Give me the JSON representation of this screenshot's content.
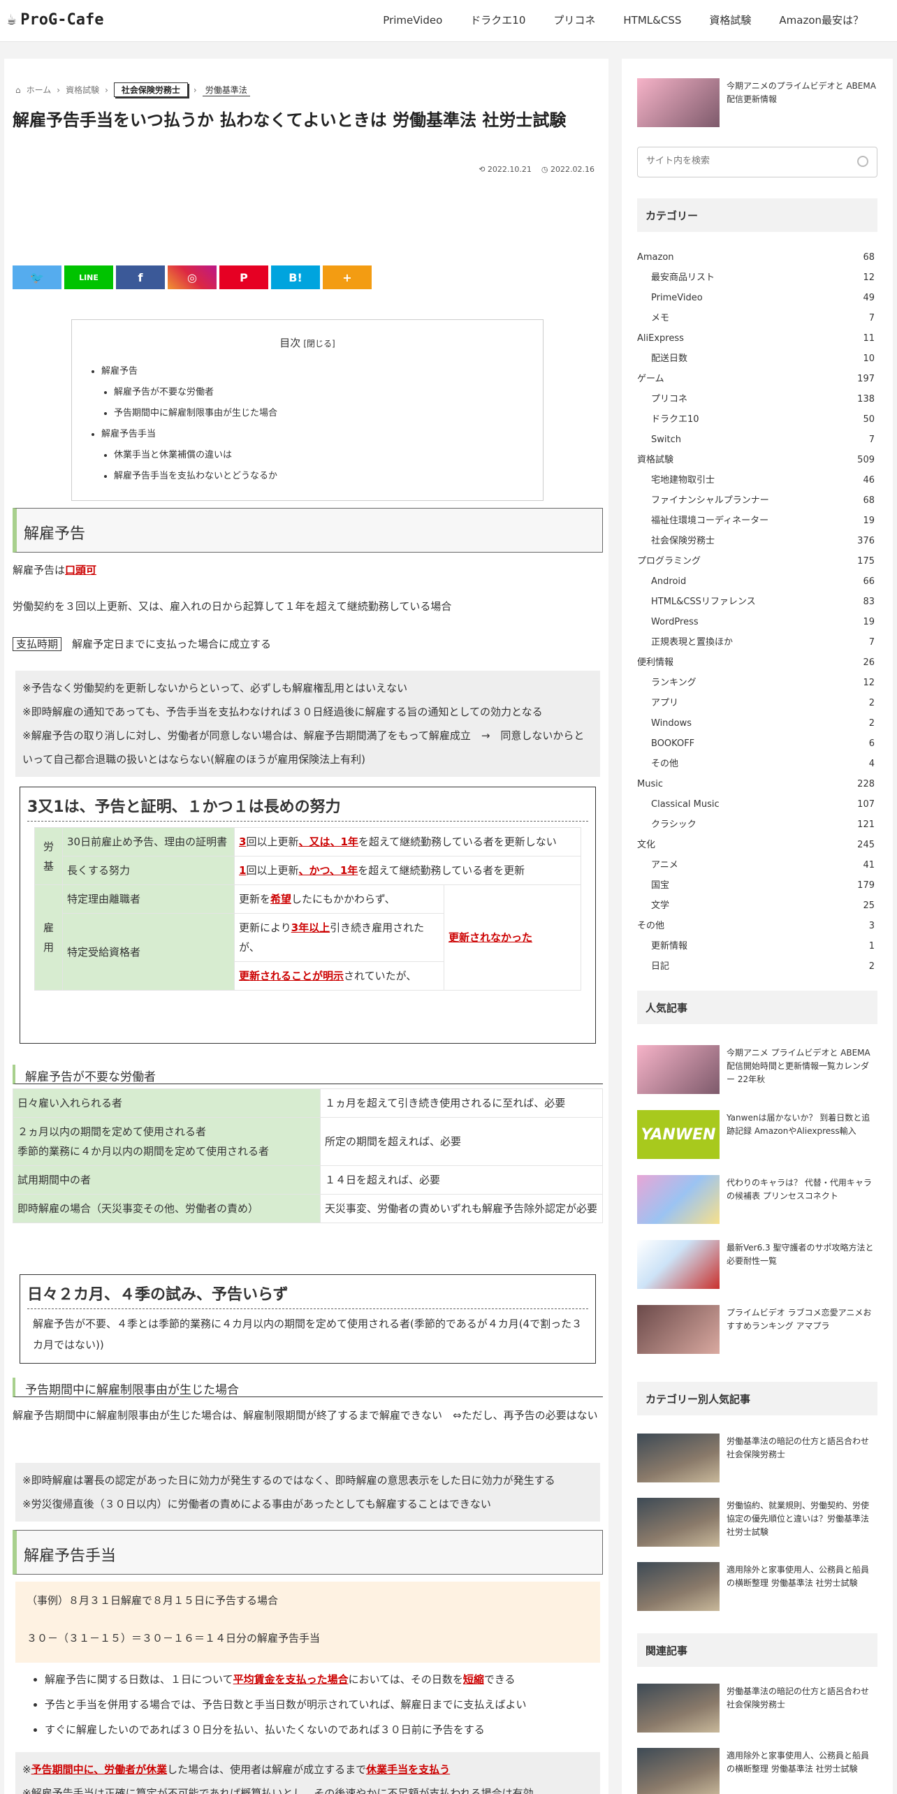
{
  "header": {
    "logo": "ProG-Cafe",
    "nav": [
      "PrimeVideo",
      "ドラクエ10",
      "プリコネ",
      "HTML&CSS",
      "資格試験",
      "Amazon最安は？"
    ]
  },
  "breadcrumb": {
    "home": "ホーム",
    "c1": "資格試験",
    "c2": "社会保険労務士",
    "c3": "労働基準法"
  },
  "article": {
    "title": "解雇予告手当をいつ払うか 払わなくてよいときは 労働基準法 社労士試験",
    "published": "2022.10.21",
    "updated": "2022.02.16",
    "share": [
      "Twitter",
      "LINE",
      "f",
      "Instagram",
      "P",
      "B!",
      "+"
    ],
    "toc": {
      "title": "目次",
      "toggle": "[閉じる]",
      "items": [
        "解雇予告",
        "解雇予告が不要な労働者",
        "予告期間中に解雇制限事由が生じた場合",
        "解雇予告手当",
        "休業手当と休業補償の違いは",
        "解雇予告手当を支払わないとどうなるか"
      ]
    },
    "h2_1": "解雇予告",
    "p1a": "解雇予告は",
    "p1b": "口頭可",
    "p2": "労働契約を３回以上更新、又は、雇入れの日から起算して１年を超えて継続勤務している場合",
    "p3k": "支払時期",
    "p3": "解雇予定日までに支払った場合に成立する",
    "note1": [
      "※予告なく労働契約を更新しないからといって、必ずしも解雇権乱用とはいえない",
      "※即時解雇の通知であっても、予告手当を支払わなければ３０日経過後に解雇する旨の通知としての効力となる",
      "※解雇予告の取り消しに対し、労働者が同意しない場合は、解雇予告期間満了をもって解雇成立　→　同意しないからといって自己都合退職の扱いとはならない(解雇のほうが雇用保険法上有利)"
    ],
    "box1": {
      "title": "3又1は、予告と証明、１かつ１は長めの努力",
      "g1": "労基",
      "g2": "雇用",
      "r1a": "30日前雇止め予告、理由の証明書",
      "r1b1": "3",
      "r1b2": "回以上更新",
      "r1b3": "、又は、1年",
      "r1b4": "を超えて継続勤務している者を更新しない",
      "r2a": "長くする努力",
      "r2b1": "1",
      "r2b2": "回以上更新",
      "r2b3": "、かつ、1年",
      "r2b4": "を超えて継続勤務している者を更新",
      "r3a": "特定理由離職者",
      "r3b1": "更新を",
      "r3b2": "希望",
      "r3b3": "したにもかかわらず、",
      "r4a": "特定受給資格者",
      "r4b1": "更新により",
      "r4b2": "3年以上",
      "r4b3": "引き続き雇用されたが、",
      "r5b1": "更新されることが明示",
      "r5b2": "されていたが、",
      "rc": "更新されなかった"
    },
    "h3_1": "解雇予告が不要な労働者",
    "t2": [
      [
        "日々雇い入れられる者",
        "１ヵ月を超えて引き続き使用されるに至れば、必要"
      ],
      [
        "２ヵ月以内の期間を定めて使用される者\n季節的業務に４か月以内の期間を定めて使用される者",
        "所定の期間を超えれば、必要"
      ],
      [
        "試用期間中の者",
        "１４日を超えれば、必要"
      ],
      [
        "即時解雇の場合（天災事変その他、労働者の責め）",
        "天災事変、労働者の責めいずれも解雇予告除外認定が必要"
      ]
    ],
    "box2": {
      "title": "日々２カ月、４季の試み、予告いらず",
      "text": "解雇予告が不要、４季とは季節的業務に４カ月以内の期間を定めて使用される者(季節的であるが４カ月(4で割った３カ月ではない))"
    },
    "h3_2": "予告期間中に解雇制限事由が生じた場合",
    "p4": "解雇予告期間中に解雇制限事由が生じた場合は、解雇制限期間が終了するまで解雇できない　⇔ただし、再予告の必要はない",
    "note2": [
      "※即時解雇は署長の認定があった日に効力が発生するのではなく、即時解雇の意思表示をした日に効力が発生する",
      "※労災復帰直後（３０日以内）に労働者の責めによる事由があったとしても解雇することはできない"
    ],
    "h2_2": "解雇予告手当",
    "peach": [
      "（事例）８月３１日解雇で８月１５日に予告する場合",
      "３０－（３１－１５）＝３０－１６＝１４日分の解雇予告手当"
    ],
    "b1a": "解雇予告に関する日数は、１日について",
    "b1b": "平均賃金を支払った場合",
    "b1c": "においては、その日数を",
    "b1d": "短縮",
    "b1e": "できる",
    "b2": "予告と手当を併用する場合では、予告日数と手当日数が明示されていれば、解雇日までに支払えばよい",
    "b3": "すぐに解雇したいのであれば３０日分を払い、払いたくないのであれば３０日前に予告をする",
    "n3a": "※",
    "n3b": "予告期間中に、労働者が休業",
    "n3c": "した場合は、使用者は解雇が成立するまで",
    "n3d": "休業手当を支払う",
    "n3e": "※解雇予告手当は正確に算定が不可能であれば概算払いとし、その後速やかに不足額が支払われる場合は有効"
  },
  "sidebar": {
    "top_card": "今期アニメのプライムビデオと ABEMA配信更新情報",
    "search_placeholder": "サイト内を検索",
    "cat_title": "カテゴリー",
    "cats": [
      [
        "Amazon",
        "68",
        0
      ],
      [
        "最安商品リスト",
        "12",
        1
      ],
      [
        "PrimeVideo",
        "49",
        1
      ],
      [
        "メモ",
        "7",
        1
      ],
      [
        "AliExpress",
        "11",
        0
      ],
      [
        "配送日数",
        "10",
        1
      ],
      [
        "ゲーム",
        "197",
        0
      ],
      [
        "プリコネ",
        "138",
        1
      ],
      [
        "ドラクエ10",
        "50",
        1
      ],
      [
        "Switch",
        "7",
        1
      ],
      [
        "資格試験",
        "509",
        0
      ],
      [
        "宅地建物取引士",
        "46",
        1
      ],
      [
        "ファイナンシャルプランナー",
        "68",
        1
      ],
      [
        "福祉住環境コーディネーター",
        "19",
        1
      ],
      [
        "社会保険労務士",
        "376",
        1
      ],
      [
        "プログラミング",
        "175",
        0
      ],
      [
        "Android",
        "66",
        1
      ],
      [
        "HTML&CSSリファレンス",
        "83",
        1
      ],
      [
        "WordPress",
        "19",
        1
      ],
      [
        "正規表現と置換ほか",
        "7",
        1
      ],
      [
        "便利情報",
        "26",
        0
      ],
      [
        "ランキング",
        "12",
        1
      ],
      [
        "アプリ",
        "2",
        1
      ],
      [
        "Windows",
        "2",
        1
      ],
      [
        "BOOKOFF",
        "6",
        1
      ],
      [
        "その他",
        "4",
        1
      ],
      [
        "Music",
        "228",
        0
      ],
      [
        "Classical Music",
        "107",
        1
      ],
      [
        "クラシック",
        "121",
        1
      ],
      [
        "文化",
        "245",
        0
      ],
      [
        "アニメ",
        "41",
        1
      ],
      [
        "国宝",
        "179",
        1
      ],
      [
        "文学",
        "25",
        1
      ],
      [
        "その他",
        "3",
        0
      ],
      [
        "更新情報",
        "1",
        1
      ],
      [
        "日記",
        "2",
        1
      ]
    ],
    "pop_title": "人気記事",
    "pop": [
      "今期アニメ プライムビデオと ABEMA配信開始時間と更新情報一覧カレンダー 22年秋",
      "Yanwenは届かないか？ 到着日数と追跡記録 AmazonやAliexpress輸入",
      "代わりのキャラは？ 代替・代用キャラの候補表 プリンセスコネクト",
      "最新Ver6.3 聖守護者のサポ攻略方法と必要耐性一覧",
      "プライムビデオ ラブコメ恋愛アニメおすすめランキング アマプラ"
    ],
    "catpop_title": "カテゴリー別人気記事",
    "catpop": [
      "労働基準法の暗記の仕方と語呂合わせ 社会保険労務士",
      "労働協約、就業規則、労働契約、労使協定の優先順位と違いは？労働基準法 社労士試験",
      "適用除外と家事使用人、公務員と船員の横断整理 労働基準法 社労士試験"
    ],
    "rel_title": "関連記事",
    "rel": [
      "労働基準法の暗記の仕方と語呂合わせ 社会保険労務士",
      "適用除外と家事使用人、公務員と船員の横断整理 労働基準法 社労士試験"
    ],
    "colors": {
      "accent": "#a8d08d",
      "twitter": "#55acee",
      "line": "#00c300",
      "facebook": "#3b5998",
      "pinterest": "#e60023",
      "hatena": "#00a4de",
      "more": "#f39c12"
    }
  }
}
